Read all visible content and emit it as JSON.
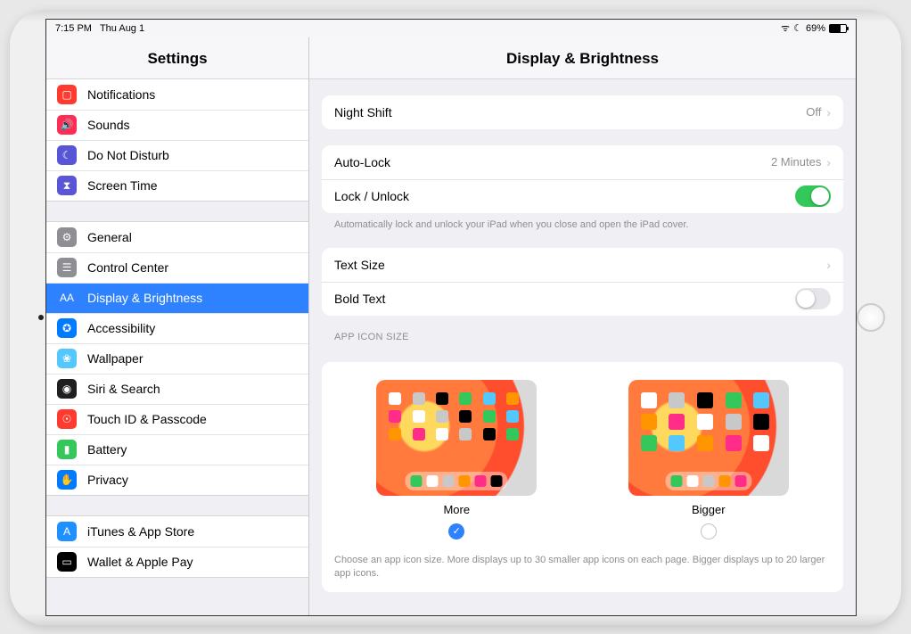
{
  "status": {
    "time": "7:15 PM",
    "date": "Thu Aug 1",
    "battery": "69%"
  },
  "sidebar": {
    "title": "Settings",
    "g1": [
      {
        "label": "Notifications",
        "color": "#ff3b30",
        "glyph": "▢"
      },
      {
        "label": "Sounds",
        "color": "#ff2d55",
        "glyph": "🔊"
      },
      {
        "label": "Do Not Disturb",
        "color": "#5856d6",
        "glyph": "☾"
      },
      {
        "label": "Screen Time",
        "color": "#5856d6",
        "glyph": "⧗"
      }
    ],
    "g2": [
      {
        "label": "General",
        "color": "#8e8e93",
        "glyph": "⚙"
      },
      {
        "label": "Control Center",
        "color": "#8e8e93",
        "glyph": "☰"
      },
      {
        "label": "Display & Brightness",
        "color": "#2f82ff",
        "glyph": "AA",
        "selected": true
      },
      {
        "label": "Accessibility",
        "color": "#007aff",
        "glyph": "✪"
      },
      {
        "label": "Wallpaper",
        "color": "#54c7fc",
        "glyph": "❀"
      },
      {
        "label": "Siri & Search",
        "color": "#1f1f1f",
        "glyph": "◉"
      },
      {
        "label": "Touch ID & Passcode",
        "color": "#ff3b30",
        "glyph": "☉"
      },
      {
        "label": "Battery",
        "color": "#34c759",
        "glyph": "▮"
      },
      {
        "label": "Privacy",
        "color": "#007aff",
        "glyph": "✋"
      }
    ],
    "g3": [
      {
        "label": "iTunes & App Store",
        "color": "#1e90ff",
        "glyph": "A"
      },
      {
        "label": "Wallet & Apple Pay",
        "color": "#000",
        "glyph": "▭"
      }
    ]
  },
  "pane": {
    "title": "Display & Brightness",
    "night_shift": {
      "label": "Night Shift",
      "value": "Off"
    },
    "auto_lock": {
      "label": "Auto-Lock",
      "value": "2 Minutes"
    },
    "lock_unlock": {
      "label": "Lock / Unlock",
      "on": true
    },
    "lock_note": "Automatically lock and unlock your iPad when you close and open the iPad cover.",
    "text_size": {
      "label": "Text Size"
    },
    "bold_text": {
      "label": "Bold Text",
      "on": false
    },
    "icon_section": "APP ICON SIZE",
    "more": {
      "label": "More",
      "checked": true
    },
    "bigger": {
      "label": "Bigger",
      "checked": false
    },
    "icon_note": "Choose an app icon size. More displays up to 30 smaller app icons on each page. Bigger displays up to 20 larger app icons."
  }
}
